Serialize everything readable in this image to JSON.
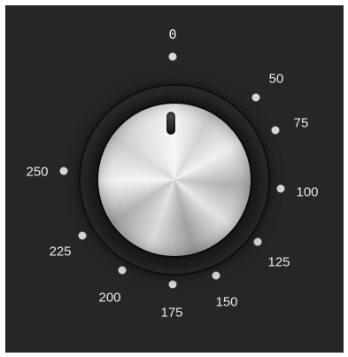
{
  "dial": {
    "ticks": [
      {
        "id": "0",
        "label": "0"
      },
      {
        "id": "50",
        "label": "50"
      },
      {
        "id": "75",
        "label": "75"
      },
      {
        "id": "100",
        "label": "100"
      },
      {
        "id": "125",
        "label": "125"
      },
      {
        "id": "150",
        "label": "150"
      },
      {
        "id": "175",
        "label": "175"
      },
      {
        "id": "200",
        "label": "200"
      },
      {
        "id": "225",
        "label": "225"
      },
      {
        "id": "250",
        "label": "250"
      }
    ],
    "selected": "0"
  },
  "colors": {
    "panel": "#262626",
    "dot": "#d8d8d8",
    "text": "#e9e9e9"
  }
}
